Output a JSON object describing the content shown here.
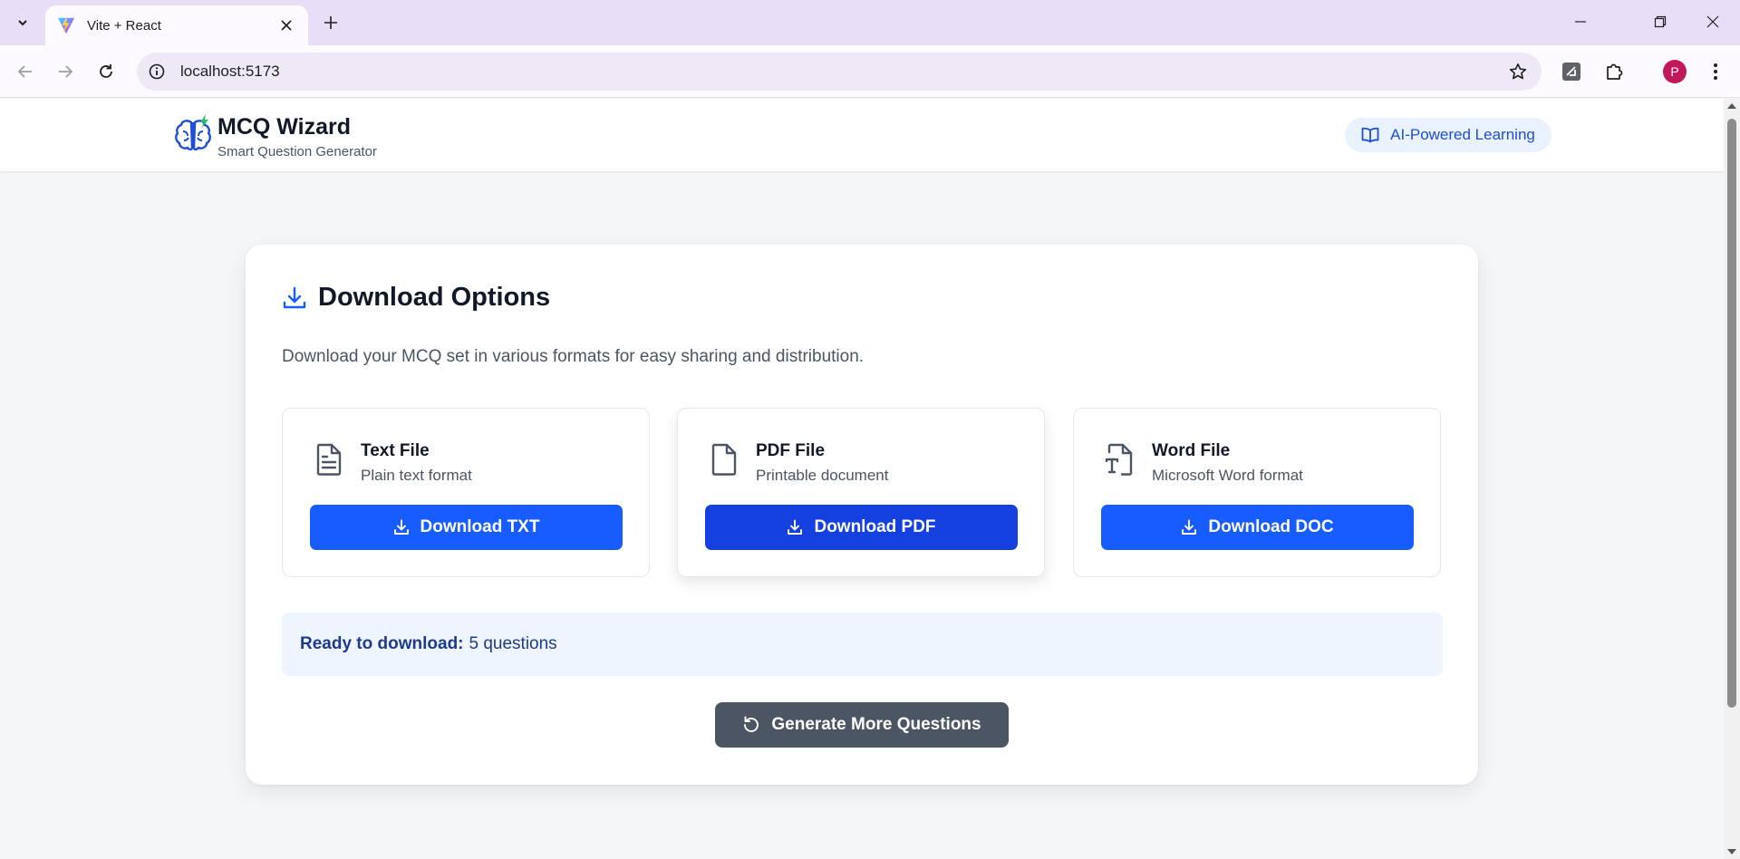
{
  "browser": {
    "tab_title": "Vite + React",
    "url": "localhost:5173",
    "profile_initial": "P"
  },
  "header": {
    "title": "MCQ Wizard",
    "subtitle": "Smart Question Generator",
    "badge": "AI-Powered Learning",
    "logo_icon": "brain-icon"
  },
  "download": {
    "title": "Download Options",
    "description": "Download your MCQ set in various formats for easy sharing and distribution.",
    "options": [
      {
        "name": "Text File",
        "desc": "Plain text format",
        "button": "Download TXT",
        "icon": "text-file-icon"
      },
      {
        "name": "PDF File",
        "desc": "Printable document",
        "button": "Download PDF",
        "icon": "file-icon"
      },
      {
        "name": "Word File",
        "desc": "Microsoft Word format",
        "button": "Download DOC",
        "icon": "word-file-icon"
      }
    ],
    "ready_label": "Ready to download:",
    "ready_value": "5 questions",
    "generate_button": "Generate More Questions"
  },
  "colors": {
    "primary": "#175cff",
    "primary_active": "#1340df",
    "secondary": "#4b5563",
    "info_bg": "#eef5ff",
    "tabbar_bg": "#e9def7"
  }
}
